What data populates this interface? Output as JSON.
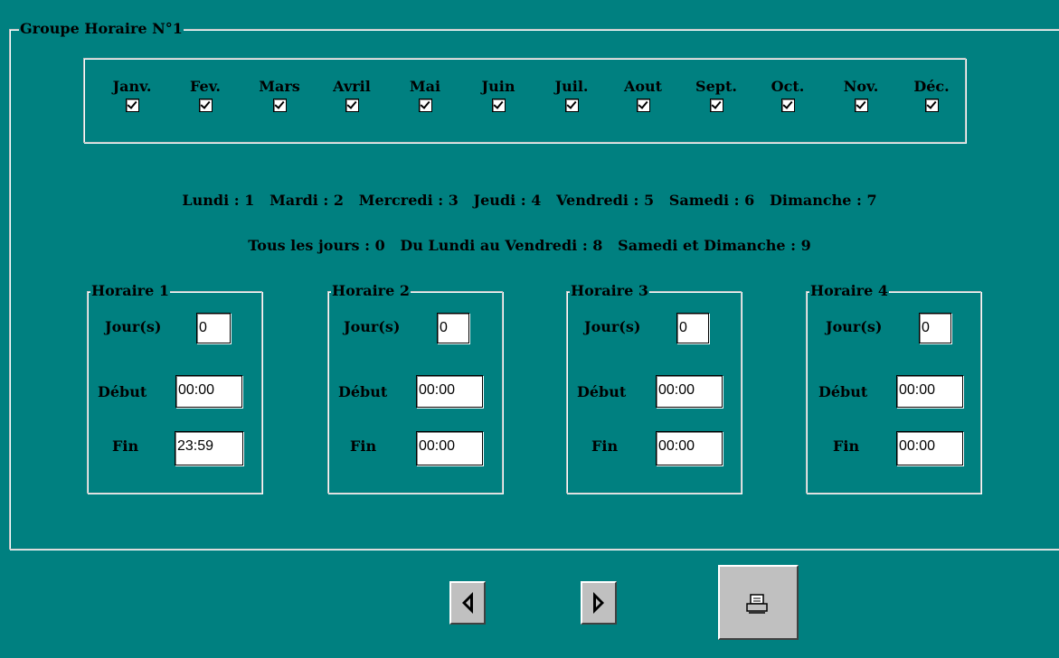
{
  "group_title": "Groupe Horaire N°1",
  "months": [
    {
      "label": "Janv.",
      "checked": true
    },
    {
      "label": "Fev.",
      "checked": true
    },
    {
      "label": "Mars",
      "checked": true
    },
    {
      "label": "Avril",
      "checked": true
    },
    {
      "label": "Mai",
      "checked": true
    },
    {
      "label": "Juin",
      "checked": true
    },
    {
      "label": "Juil.",
      "checked": true
    },
    {
      "label": "Aout",
      "checked": true
    },
    {
      "label": "Sept.",
      "checked": true
    },
    {
      "label": "Oct.",
      "checked": true
    },
    {
      "label": "Nov.",
      "checked": true
    },
    {
      "label": "Déc.",
      "checked": true
    }
  ],
  "legend_days": "Lundi : 1   Mardi : 2   Mercredi : 3   Jeudi : 4   Vendredi : 5   Samedi : 6   Dimanche : 7",
  "legend_groups": "Tous les jours : 0   Du Lundi au Vendredi : 8   Samedi et Dimanche : 9",
  "labels": {
    "days": "Jour(s)",
    "start": "Début",
    "end": "Fin"
  },
  "schedules": [
    {
      "title": "Horaire 1",
      "days": "0",
      "start": "00:00",
      "end": "23:59"
    },
    {
      "title": "Horaire 2",
      "days": "0",
      "start": "00:00",
      "end": "00:00"
    },
    {
      "title": "Horaire 3",
      "days": "0",
      "start": "00:00",
      "end": "00:00"
    },
    {
      "title": "Horaire 4",
      "days": "0",
      "start": "00:00",
      "end": "00:00"
    }
  ],
  "toolbar": {
    "prev_icon": "triangle-left-icon",
    "next_icon": "triangle-right-icon",
    "print_icon": "printer-icon"
  }
}
